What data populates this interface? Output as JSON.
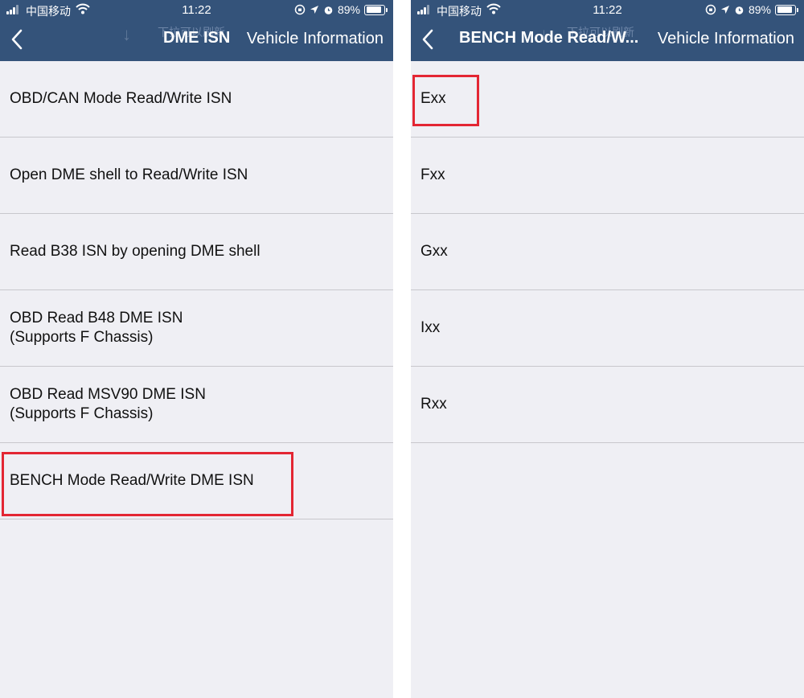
{
  "status_bar": {
    "carrier": "中国移动",
    "time": "11:22",
    "battery": "89%"
  },
  "left_screen": {
    "ghost_text": "下拉可以刷新",
    "title": "DME ISN",
    "subtitle": "Vehicle Information",
    "items": [
      {
        "label": "OBD/CAN Mode Read/Write ISN"
      },
      {
        "label": "Open DME shell to Read/Write ISN"
      },
      {
        "label": "Read B38 ISN by opening DME shell"
      },
      {
        "label": "OBD Read B48 DME ISN\n(Supports F Chassis)"
      },
      {
        "label": "OBD Read MSV90 DME ISN\n(Supports F Chassis)"
      },
      {
        "label": "BENCH Mode Read/Write DME ISN",
        "highlighted": true
      }
    ]
  },
  "right_screen": {
    "ghost_text": "下拉可以刷新",
    "title": "BENCH Mode Read/W...",
    "subtitle": "Vehicle Information",
    "items": [
      {
        "label": "Exx",
        "highlighted": true
      },
      {
        "label": "Fxx"
      },
      {
        "label": "Gxx"
      },
      {
        "label": "Ixx"
      },
      {
        "label": "Rxx"
      }
    ]
  },
  "colors": {
    "navbar": "#34537a",
    "list_background": "#efeff4",
    "separator": "#c8c7cc",
    "highlight": "#e32633"
  },
  "icons": [
    "back-chevron-icon",
    "signal-icon",
    "wifi-icon",
    "orientation-lock-icon",
    "location-icon",
    "alarm-icon",
    "battery-icon"
  ]
}
